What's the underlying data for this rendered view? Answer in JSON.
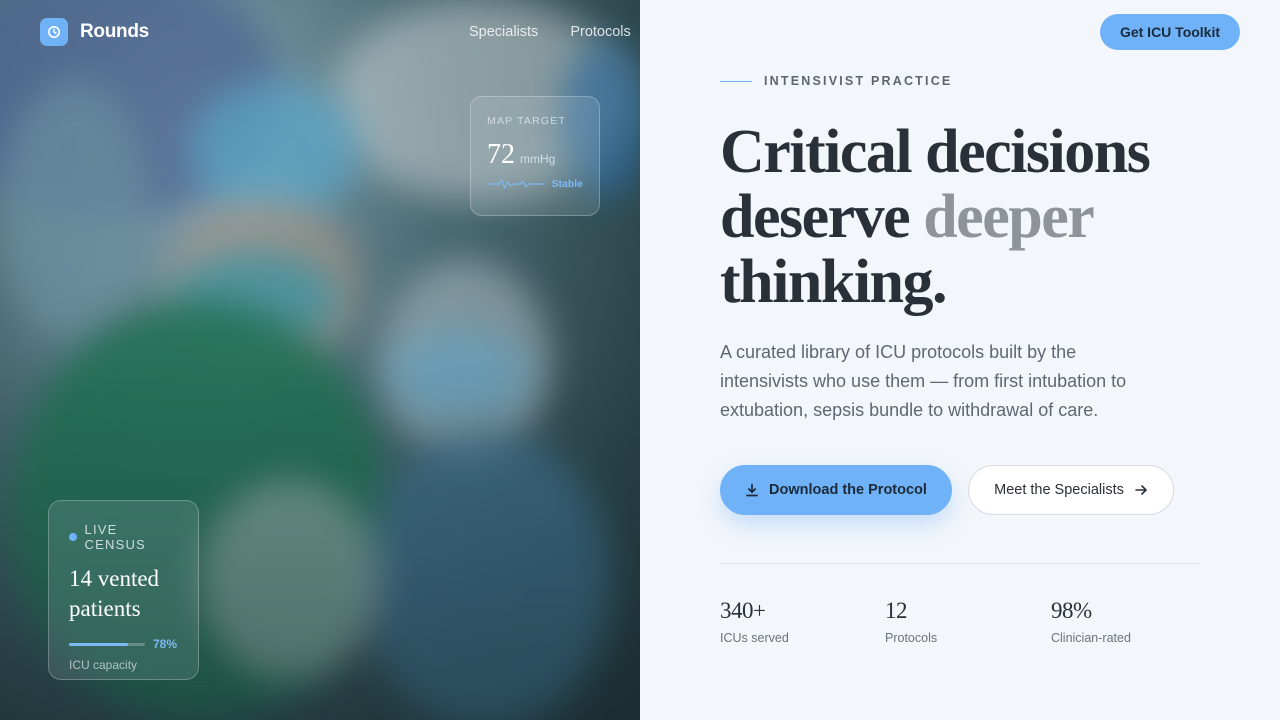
{
  "brand": {
    "name": "Rounds"
  },
  "nav": {
    "items": [
      "Specialists",
      "Protocols"
    ]
  },
  "header": {
    "cta_label": "Get ICU Toolkit"
  },
  "map_card": {
    "label": "MAP TARGET",
    "value": "72",
    "unit": "mmHg",
    "status": "Stable"
  },
  "census_card": {
    "label": "LIVE CENSUS",
    "line1": "14 vented",
    "line2": "patients",
    "capacity_percent": "78%",
    "capacity_fraction": 0.78,
    "caption": "ICU capacity"
  },
  "hero": {
    "eyebrow": "INTENSIVIST PRACTICE",
    "headline_part1": "Critical decisions",
    "headline_part2": "deserve",
    "headline_accent": "deeper",
    "headline_part3": "thinking.",
    "lede": "A curated library of ICU protocols built by the intensivists who use them — from first intubation to extubation, sepsis bundle to withdrawal of care.",
    "primary_cta": "Download the Protocol",
    "secondary_cta": "Meet the Specialists"
  },
  "stats": [
    {
      "value": "340+",
      "label": "ICUs served"
    },
    {
      "value": "12",
      "label": "Protocols"
    },
    {
      "value": "98%",
      "label": "Clinician-rated"
    }
  ],
  "colors": {
    "accent": "#6fb2f7",
    "ink": "#2a3038",
    "muted": "#8e9499",
    "page_bg": "#f3f6fa"
  }
}
